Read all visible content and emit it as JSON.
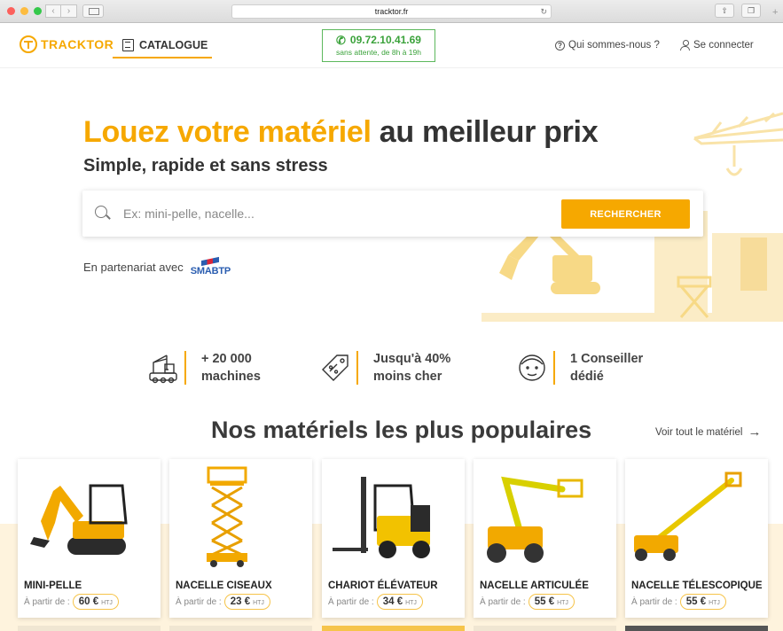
{
  "browser": {
    "url": "tracktor.fr"
  },
  "header": {
    "logo_text": "TRACKTOR",
    "catalogue_label": "CATALOGUE",
    "phone_number": "09.72.10.41.69",
    "phone_subtitle": "sans attente, de 8h à 19h",
    "about_label": "Qui sommes-nous ?",
    "login_label": "Se connecter"
  },
  "hero": {
    "title_highlight": "Louez votre matériel",
    "title_rest": " au meilleur prix",
    "subtitle": "Simple, rapide et sans stress",
    "search_placeholder": "Ex: mini-pelle, nacelle...",
    "search_button": "RECHERCHER",
    "partner_text": "En partenariat avec",
    "partner_logo_text": "SMABTP"
  },
  "features": [
    {
      "icon": "crane-truck-icon",
      "line1": "+ 20 000",
      "line2": "machines"
    },
    {
      "icon": "price-tag-icon",
      "line1": "Jusqu'à 40%",
      "line2": "moins cher"
    },
    {
      "icon": "advisor-face-icon",
      "line1": "1 Conseiller",
      "line2": "dédié"
    }
  ],
  "popular": {
    "title": "Nos matériels les plus populaires",
    "see_all": "Voir tout le matériel",
    "price_prefix": "À partir de :",
    "price_unit": "HTJ",
    "items": [
      {
        "name": "MINI-PELLE",
        "price": "60 €",
        "icon": "mini-excavator-icon"
      },
      {
        "name": "NACELLE CISEAUX",
        "price": "23 €",
        "icon": "scissor-lift-icon"
      },
      {
        "name": "CHARIOT ÉLÉVATEUR",
        "price": "34 €",
        "icon": "forklift-icon"
      },
      {
        "name": "NACELLE ARTICULÉE",
        "price": "55 €",
        "icon": "articulated-boom-lift-icon"
      },
      {
        "name": "NACELLE TÉLESCOPIQUE",
        "price": "55 €",
        "icon": "telescopic-boom-lift-icon"
      }
    ]
  },
  "colors": {
    "brand": "#f6a800",
    "phone_green": "#3aa23a",
    "band": "#fef3dd"
  }
}
